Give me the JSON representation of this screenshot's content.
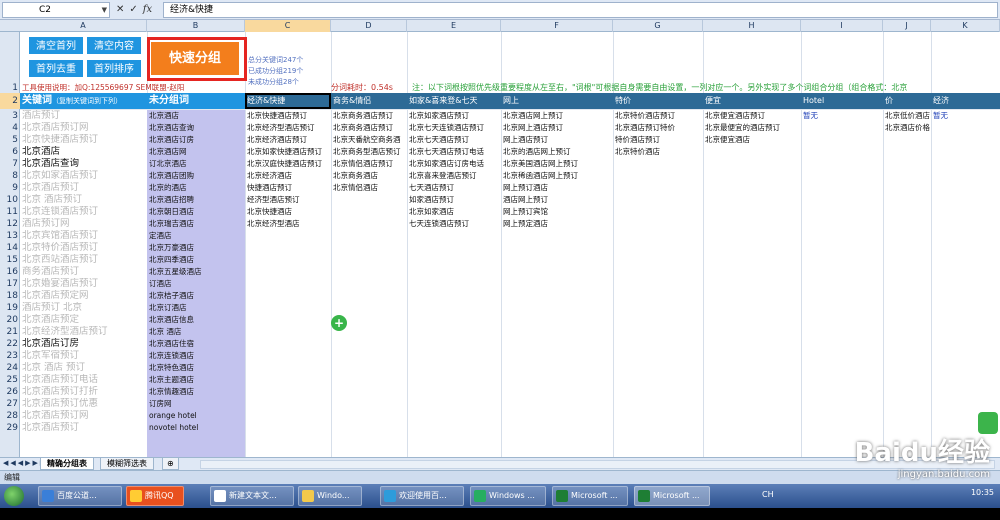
{
  "formula_bar": {
    "cell_ref": "C2",
    "content": "经济&快捷"
  },
  "columns": [
    "A",
    "B",
    "C",
    "D",
    "E",
    "F",
    "G",
    "H",
    "I",
    "J",
    "K"
  ],
  "rows": [
    "1",
    "2",
    "3",
    "4",
    "5",
    "6",
    "7",
    "8",
    "9",
    "10",
    "11",
    "12",
    "13",
    "14",
    "15",
    "16",
    "17",
    "18",
    "19",
    "20",
    "21",
    "22",
    "23",
    "24",
    "25",
    "26",
    "27",
    "28",
    "29"
  ],
  "controls": {
    "clear_first": "清空首列",
    "clear_content": "清空内容",
    "dedup_first": "首列去重",
    "sort_first": "首列排序",
    "quick_group": "快速分组"
  },
  "stats": {
    "total": "总分关键词247个",
    "grouped": "已成功分组219个",
    "ungrouped": "未成功分组28个"
  },
  "info": {
    "tool_notice": "工具使用说明：加Q:125569697  SEM联盟-赵阳",
    "timer": "分词耗时：0.54s",
    "note": "注：以下词根按照优先级重要程度从左至右，\"词根\"可根据自身需要自由设置，一列对应一个。另外实现了多个词组合分组（组合格式：北京"
  },
  "header_row": {
    "a_title": "关键词",
    "a_hint": "（复制关键词到下列）",
    "b_title": "未分组词",
    "groups": [
      "经济&快捷",
      "商务&情侣",
      "如家&喜来登&七天",
      "网上",
      "特价",
      "便宜",
      "Hotel",
      "价",
      "经济"
    ]
  },
  "column_a": [
    {
      "t": "酒店预订",
      "c": "g"
    },
    {
      "t": "北京酒店预订网",
      "c": "g"
    },
    {
      "t": "北京快捷酒店预订",
      "c": "g"
    },
    {
      "t": "北京酒店",
      "c": "k"
    },
    {
      "t": "北京酒店查询",
      "c": "k"
    },
    {
      "t": "北京如家酒店预订",
      "c": "g"
    },
    {
      "t": "北京酒店预订",
      "c": "g"
    },
    {
      "t": "北京 酒店预订",
      "c": "g"
    },
    {
      "t": "北京连锁酒店预订",
      "c": "g"
    },
    {
      "t": "酒店预订网",
      "c": "g"
    },
    {
      "t": "北京宾馆酒店预订",
      "c": "g"
    },
    {
      "t": "北京特价酒店预订",
      "c": "g"
    },
    {
      "t": "北京西站酒店预订",
      "c": "g"
    },
    {
      "t": "商务酒店预订",
      "c": "g"
    },
    {
      "t": "北京婚宴酒店预订",
      "c": "g"
    },
    {
      "t": "北京酒店预定网",
      "c": "g"
    },
    {
      "t": "酒店预订 北京",
      "c": "g"
    },
    {
      "t": "北京酒店预定",
      "c": "g"
    },
    {
      "t": "北京经济型酒店预订",
      "c": "g"
    },
    {
      "t": "北京酒店订房",
      "c": "k"
    },
    {
      "t": "北京军宿预订",
      "c": "g"
    },
    {
      "t": "北京 酒店 预订",
      "c": "g"
    },
    {
      "t": "北京酒店预订电话",
      "c": "g"
    },
    {
      "t": "北京酒店预订打折",
      "c": "g"
    },
    {
      "t": "北京酒店预订优惠",
      "c": "g"
    },
    {
      "t": "北京酒店预订网",
      "c": "g"
    },
    {
      "t": "北京酒店预订",
      "c": "g"
    }
  ],
  "column_b": [
    "北京酒店",
    "北京酒店查询",
    "北京酒店订房",
    "北京酒店网",
    "订北京酒店",
    "北京酒店团购",
    "北京的酒店",
    "北京酒店招聘",
    "北京朝日酒店",
    "北京瑞吉酒店",
    "定酒店",
    "北京万豪酒店",
    "北京四季酒店",
    "北京五星级酒店",
    "订酒店",
    "北京桔子酒店",
    "北京订酒店",
    "北京酒店信息",
    "北京 酒店",
    "北京酒店住宿",
    "北京连锁酒店",
    "北京特色酒店",
    "北京主题酒店",
    "北京情趣酒店",
    "订房网",
    "orange hotel",
    "novotel hotel"
  ],
  "column_c": [
    "北京快捷酒店预订",
    "北京经济型酒店预订",
    "北京经济酒店预订",
    "北京如家快捷酒店预订",
    "北京汉庭快捷酒店预订",
    "北京经济酒店",
    "快捷酒店预订",
    "经济型酒店预订",
    "北京快捷酒店",
    "北京经济型酒店"
  ],
  "column_d": [
    "北京商务酒店预订",
    "北京商务酒店预订",
    "北京天番航空商务酒",
    "北京商务型酒店预订",
    "北京情侣酒店预订",
    "北京商务酒店",
    "北京情侣酒店"
  ],
  "column_e": [
    "北京如家酒店预订",
    "北京七天连锁酒店预订",
    "北京七天酒店预订",
    "北京七天酒店预订电话",
    "北京如家酒店订房电话",
    "北京喜来登酒店预订",
    "七天酒店预订",
    "如家酒店预订",
    "北京如家酒店",
    "七天连锁酒店预订"
  ],
  "column_f": [
    "北京酒店网上预订",
    "北京网上酒店预订",
    "网上酒店预订",
    "北京的酒店网上预订",
    "北京美国酒店网上预订",
    "北京稀函酒店网上预订",
    "网上预订酒店",
    "酒店网上预订",
    "网上预订宾馆",
    "网上预定酒店"
  ],
  "column_g": [
    "北京特价酒店预订",
    "北京酒店预订特价",
    "特价酒店预订",
    "北京特价酒店"
  ],
  "column_h": [
    "北京便宜酒店预订",
    "北京最便宜的酒店预订",
    "北京便宜酒店"
  ],
  "column_i": [
    "暂无"
  ],
  "column_j": [
    "北京低价酒店",
    "北京酒店价格"
  ],
  "column_k": [
    "暂无"
  ],
  "sheet_tabs": [
    "精确分组表",
    "模糊筛选表"
  ],
  "status": "编辑",
  "taskbar": {
    "items": [
      "百度公道...",
      "腾讯QQ",
      "新建文本文...",
      "Windo...",
      "欢迎使用百...",
      "Windows ...",
      "Microsoft ...",
      "Microsoft ..."
    ],
    "lang": "CH",
    "clock": "10:35"
  },
  "watermark": {
    "brand": "Baidu经验",
    "url": "jingyan.baidu.com"
  },
  "colors": {
    "accent_blue": "#1f95e0",
    "orange": "#f37e1c",
    "highlight_red": "#e52521",
    "purple_col": "#c3c3ee",
    "dark_header": "#2d6a96"
  }
}
